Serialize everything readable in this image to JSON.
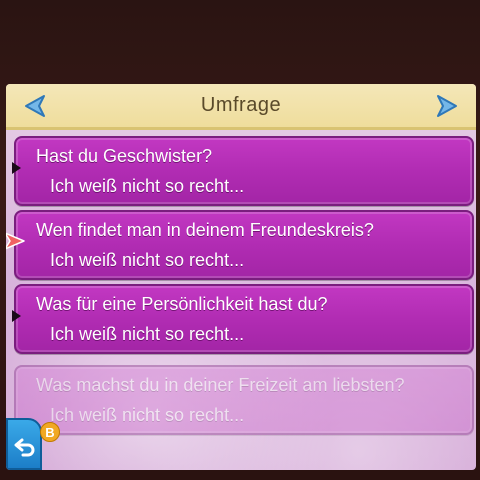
{
  "header": {
    "title": "Umfrage",
    "prev_icon": "triangle-left-icon",
    "next_icon": "triangle-right-icon"
  },
  "survey": {
    "items": [
      {
        "question": "Hast du Geschwister?",
        "answer": "Ich weiß nicht so recht..."
      },
      {
        "question": "Wen findet man in deinem Freundeskreis?",
        "answer": "Ich weiß nicht so recht..."
      },
      {
        "question": "Was für eine Persönlichkeit hast du?",
        "answer": "Ich weiß nicht so recht..."
      },
      {
        "question": "Was machst du in deiner Freizeit am liebsten?",
        "answer": "Ich weiß nicht so recht..."
      }
    ]
  },
  "controls": {
    "back_icon": "back-arrow-icon",
    "b_button_label": "B"
  },
  "colors": {
    "card": "#b12cb3",
    "header": "#f4e7b8",
    "back_button": "#1c7ec8"
  }
}
